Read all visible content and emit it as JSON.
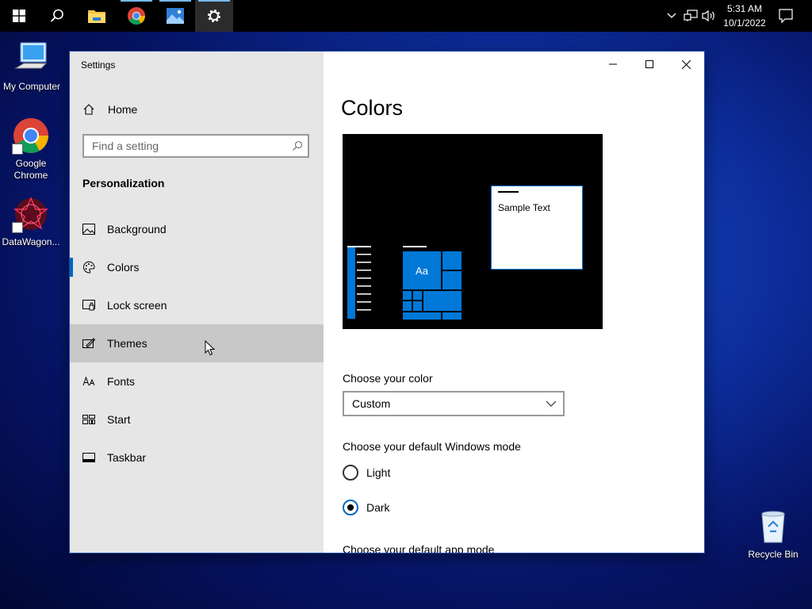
{
  "taskbar": {
    "start_icon": "windows-logo-icon",
    "search_icon": "search-icon",
    "apps": [
      {
        "name": "file-explorer-icon"
      },
      {
        "name": "chrome-icon"
      },
      {
        "name": "photos-icon"
      },
      {
        "name": "settings-gear-icon"
      }
    ],
    "time": "5:31 AM",
    "date": "10/1/2022",
    "accent": "#76b9ed"
  },
  "desktop": {
    "icons": [
      {
        "label": "My Computer"
      },
      {
        "label": "Google Chrome"
      },
      {
        "label": "DataWagon..."
      },
      {
        "label": "Recycle Bin"
      }
    ]
  },
  "window": {
    "title": "Settings",
    "sidebar": {
      "home": "Home",
      "search_placeholder": "Find a setting",
      "section": "Personalization",
      "items": [
        {
          "label": "Background",
          "icon": "image-icon"
        },
        {
          "label": "Colors",
          "icon": "palette-icon"
        },
        {
          "label": "Lock screen",
          "icon": "lock-screen-icon"
        },
        {
          "label": "Themes",
          "icon": "themes-icon"
        },
        {
          "label": "Fonts",
          "icon": "fonts-icon"
        },
        {
          "label": "Start",
          "icon": "start-icon"
        },
        {
          "label": "Taskbar",
          "icon": "taskbar-icon"
        }
      ]
    },
    "main": {
      "title": "Colors",
      "preview": {
        "sample_text": "Sample Text",
        "tile_text": "Aa",
        "accent": "#0078d7"
      },
      "choose_color_label": "Choose your color",
      "choose_color_value": "Custom",
      "windows_mode_label": "Choose your default Windows mode",
      "windows_mode_options": [
        {
          "label": "Light",
          "checked": false
        },
        {
          "label": "Dark",
          "checked": true
        }
      ],
      "app_mode_label": "Choose your default app mode"
    }
  }
}
